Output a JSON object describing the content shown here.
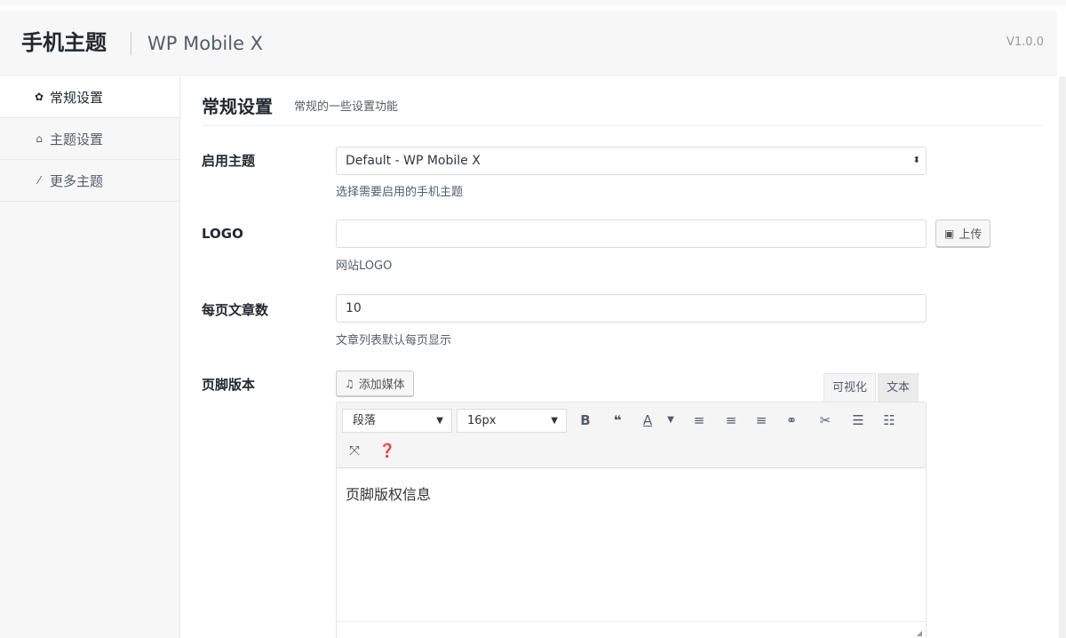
{
  "header": {
    "title": "手机主题",
    "subtitle": "WP Mobile X",
    "version": "V1.0.0"
  },
  "sidebar": {
    "items": [
      {
        "label": "常规设置",
        "icon": "gear-icon",
        "active": true
      },
      {
        "label": "主题设置",
        "icon": "home-icon",
        "active": false
      },
      {
        "label": "更多主题",
        "icon": "magic-wand-icon",
        "active": false
      }
    ]
  },
  "section": {
    "title": "常规设置",
    "description": "常规的一些设置功能"
  },
  "fields": {
    "theme": {
      "label": "启用主题",
      "value": "Default - WP Mobile X",
      "hint": "选择需要启用的手机主题"
    },
    "logo": {
      "label": "LOGO",
      "value": "",
      "hint": "网站LOGO",
      "upload_label": "上传"
    },
    "posts_per_page": {
      "label": "每页文章数",
      "value": "10",
      "hint": "文章列表默认每页显示"
    },
    "footer": {
      "label": "页脚版本",
      "add_media_label": "添加媒体",
      "tab_visual": "可视化",
      "tab_text": "文本",
      "format_select": "段落",
      "size_select": "16px",
      "content": "页脚版权信息"
    }
  },
  "colors": {
    "header_bg": "#f7f7f7",
    "sidebar_bg": "#f7f7f7",
    "text": "#23282d",
    "muted": "#555d66"
  }
}
